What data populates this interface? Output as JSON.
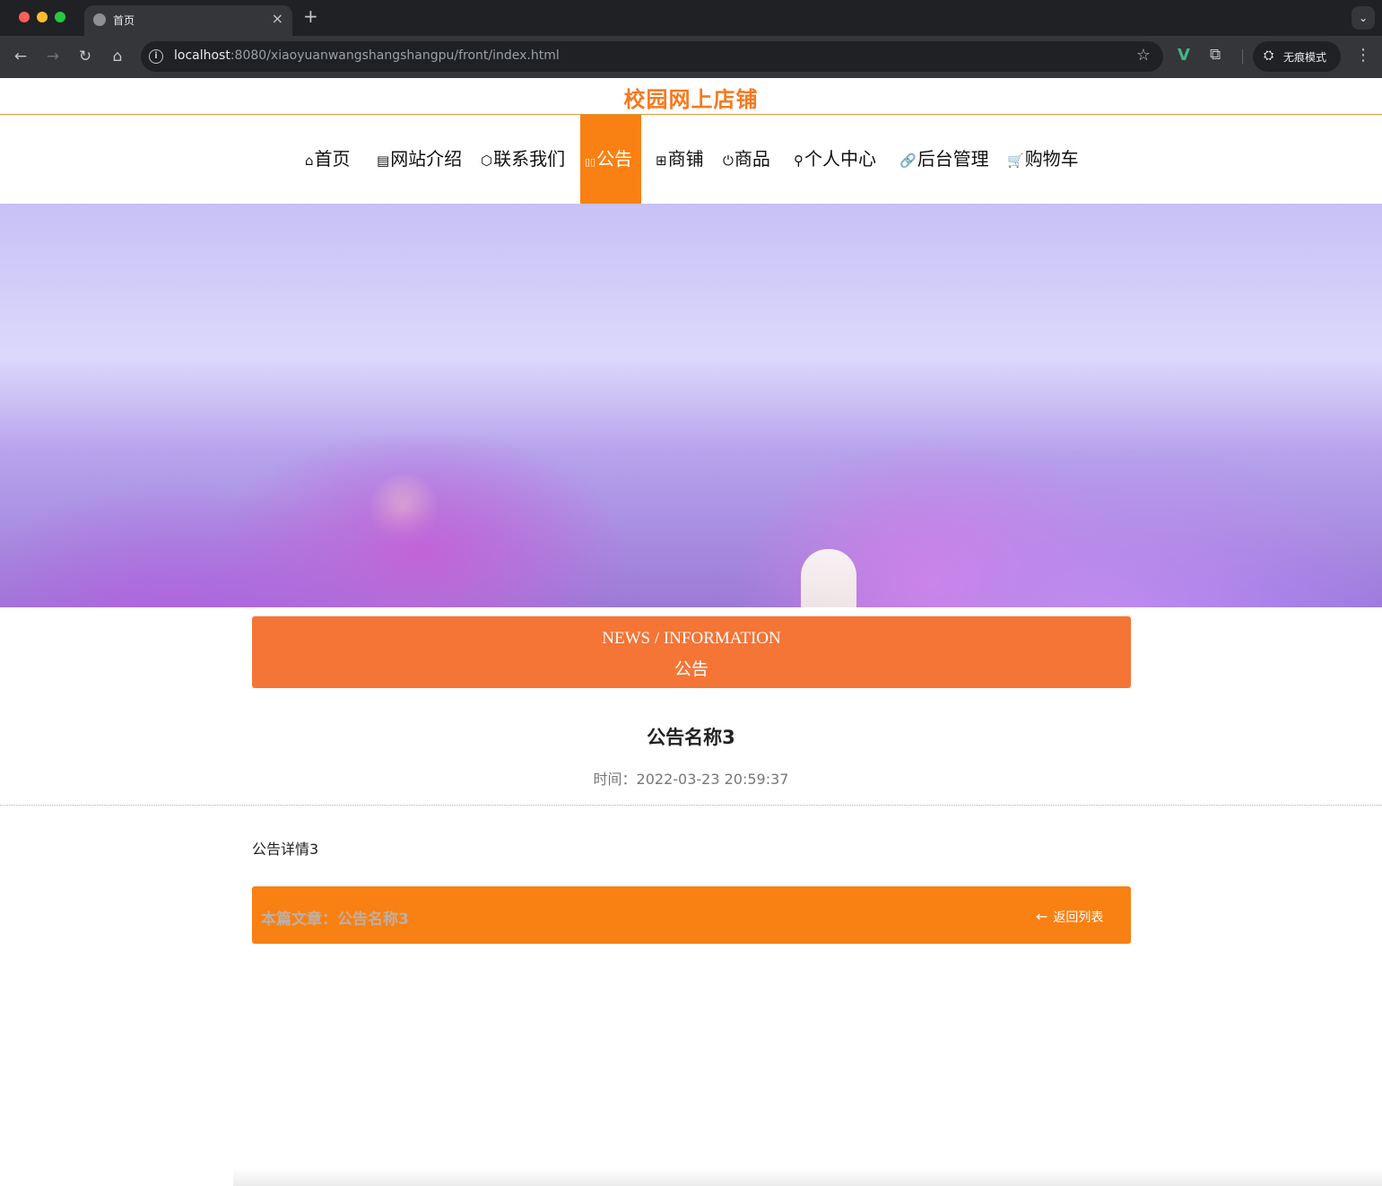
{
  "browser": {
    "tab_title": "首页",
    "tab_close": "×",
    "new_tab": "+",
    "tab_menu_icon": "⌄",
    "url_host": "localhost",
    "url_rest": ":8080/xiaoyuanwangshangshangpu/front/index.html",
    "back_icon": "←",
    "forward_icon": "→",
    "reload_icon": "↻",
    "home_icon": "⌂",
    "info_icon": "i",
    "star_icon": "☆",
    "ext_vue_icon": "V",
    "ext_puzzle_icon": "⧉",
    "incognito_icon": "⛭",
    "incognito_label": "无痕模式",
    "more_icon": "⋮"
  },
  "site": {
    "title": "校园网上店铺",
    "accent_color": "#f98012"
  },
  "nav": {
    "items": [
      {
        "icon": "⌂",
        "label": "首页"
      },
      {
        "icon": "▤",
        "label": "网站介绍"
      },
      {
        "icon": "⬡",
        "label": "联系我们"
      },
      {
        "icon": "▯▯",
        "label": "公告",
        "active": true
      },
      {
        "icon": "⊞",
        "label": "商铺"
      },
      {
        "icon": "⏻",
        "label": "商品"
      },
      {
        "icon": "⚲",
        "label": "个人中心"
      },
      {
        "icon": "🔗",
        "label": "后台管理"
      },
      {
        "icon": "🛒",
        "label": "购物车"
      }
    ]
  },
  "carousel": {
    "slide_count": 3,
    "active_index": 0
  },
  "section": {
    "title_en": "NEWS / INFORMATION",
    "title_cn": "公告"
  },
  "article": {
    "title": "公告名称3",
    "time_label": "时间：",
    "time_value": "2022-03-23 20:59:37",
    "body": "公告详情3"
  },
  "footer_bar": {
    "current_label": "本篇文章：",
    "current_title": "公告名称3",
    "back_icon": "←",
    "back_label": "返回列表"
  }
}
